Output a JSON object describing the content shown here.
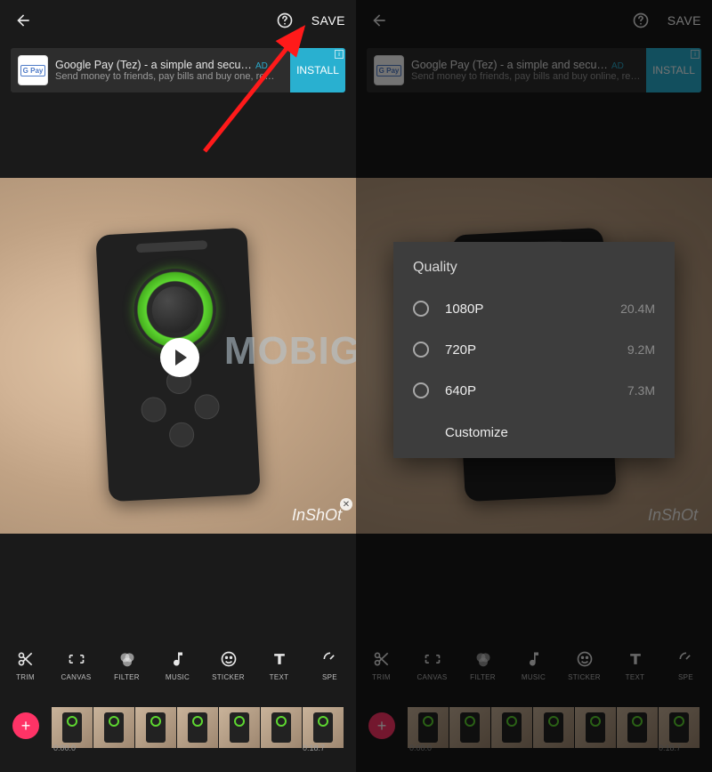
{
  "header": {
    "save_label": "SAVE"
  },
  "ad": {
    "icon_text": "G Pay",
    "title": "Google Pay (Tez) - a simple and secu…",
    "badge": "AD",
    "subtitle_left": "Send money to friends, pay bills and buy o",
    "subtitle_left_tail": "ne, re…",
    "subtitle_right": "Send money to friends, pay bills and buy online, re…",
    "install": "INSTALL"
  },
  "preview": {
    "watermark": "InShOt",
    "bg_watermark": "MOBIG"
  },
  "toolbar": {
    "items": [
      {
        "label": "TRIM",
        "icon": "scissors"
      },
      {
        "label": "CANVAS",
        "icon": "canvas"
      },
      {
        "label": "FILTER",
        "icon": "filter"
      },
      {
        "label": "MUSIC",
        "icon": "music"
      },
      {
        "label": "STICKER",
        "icon": "sticker"
      },
      {
        "label": "TEXT",
        "icon": "text"
      },
      {
        "label": "SPE",
        "icon": "speed"
      }
    ]
  },
  "timeline": {
    "start": "0:00.0",
    "end": "0:18.7"
  },
  "dialog": {
    "title": "Quality",
    "options": [
      {
        "label": "1080P",
        "size": "20.4M"
      },
      {
        "label": "720P",
        "size": "9.2M"
      },
      {
        "label": "640P",
        "size": "7.3M"
      }
    ],
    "customize": "Customize"
  }
}
